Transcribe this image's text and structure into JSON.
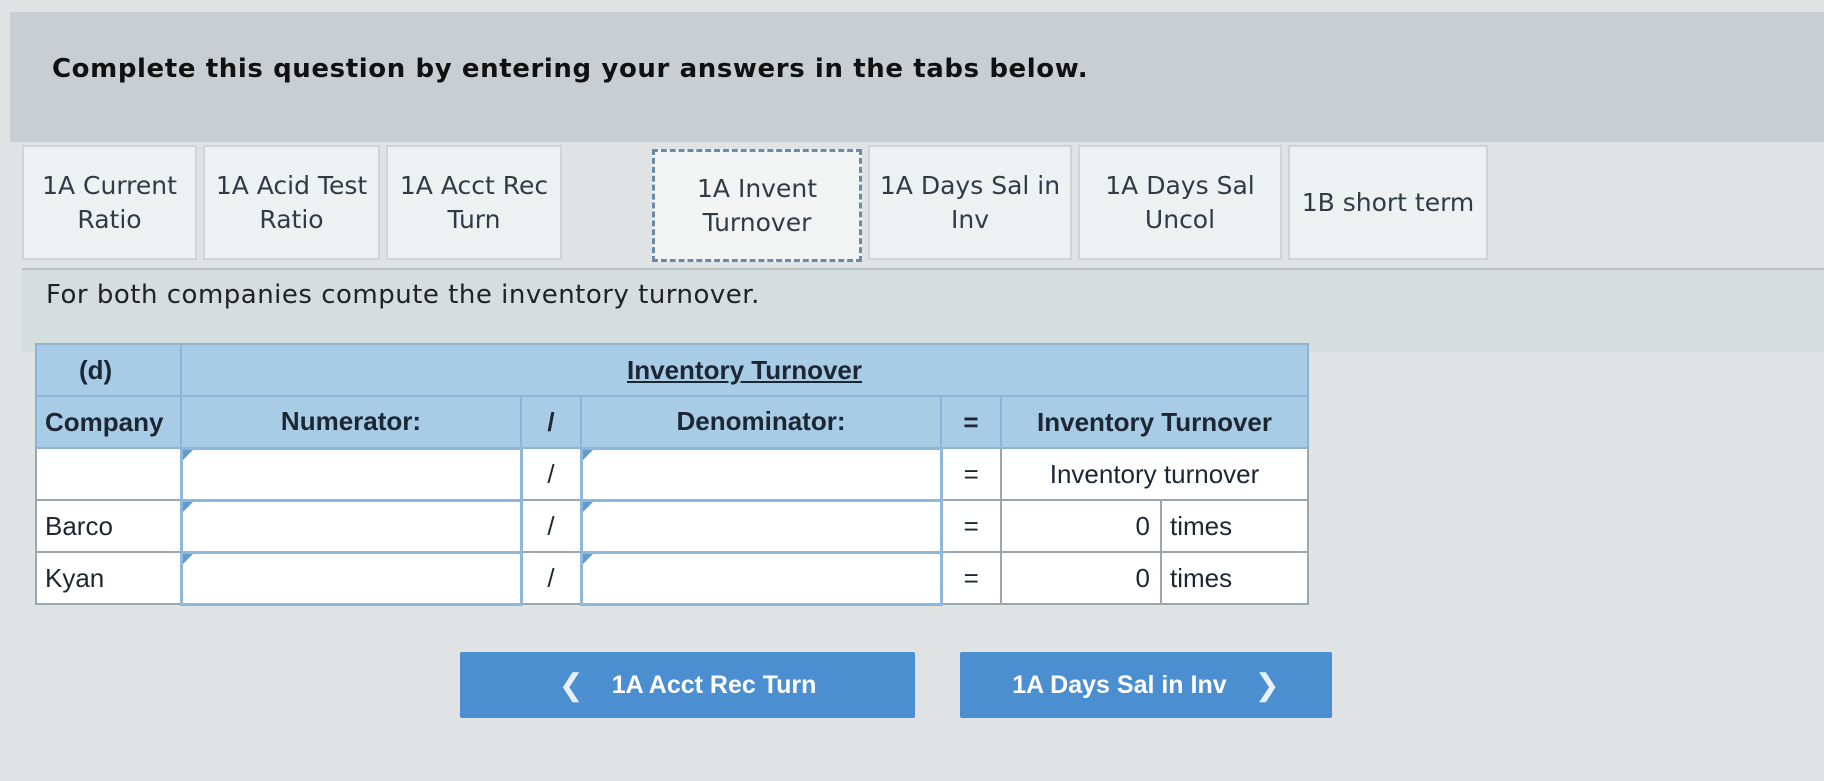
{
  "instruction": "Complete this question by entering your answers in the tabs below.",
  "tabs": [
    {
      "line1": "1A Current",
      "line2": "Ratio"
    },
    {
      "line1": "1A Acid Test",
      "line2": "Ratio"
    },
    {
      "line1": "1A Acct Rec",
      "line2": "Turn"
    },
    {
      "line1": "1A Invent",
      "line2": "Turnover"
    },
    {
      "line1": "1A Days Sal in",
      "line2": "Inv"
    },
    {
      "line1": "1A Days Sal",
      "line2": "Uncol"
    },
    {
      "line1": "1B short term",
      "line2": ""
    }
  ],
  "active_tab": "1A Invent Turnover",
  "prompt": "For both companies compute the inventory turnover.",
  "table": {
    "part_label": "(d)",
    "title": "Inventory Turnover",
    "headers": {
      "company": "Company",
      "numerator": "Numerator:",
      "divide": "/",
      "denominator": "Denominator:",
      "equals": "=",
      "result": "Inventory Turnover"
    },
    "rows": [
      {
        "company": "",
        "numerator": "",
        "denominator": "",
        "divide": "/",
        "equals": "=",
        "result_label": "Inventory turnover"
      },
      {
        "company": "Barco",
        "numerator": "",
        "denominator": "",
        "divide": "/",
        "equals": "=",
        "result_value": "0",
        "result_unit": "times"
      },
      {
        "company": "Kyan",
        "numerator": "",
        "denominator": "",
        "divide": "/",
        "equals": "=",
        "result_value": "0",
        "result_unit": "times"
      }
    ]
  },
  "nav": {
    "prev_label": "1A Acct Rec Turn",
    "next_label": "1A Days Sal in Inv",
    "prev_icon": "chevron-left-icon",
    "next_icon": "chevron-right-icon"
  }
}
